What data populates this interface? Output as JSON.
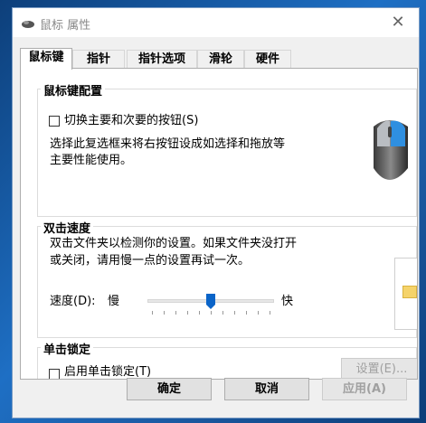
{
  "window": {
    "title": "鼠标 属性",
    "close_symbol": "✕"
  },
  "tabs": [
    {
      "label": "鼠标键",
      "active": true
    },
    {
      "label": "指针",
      "active": false
    },
    {
      "label": "指针选项",
      "active": false
    },
    {
      "label": "滑轮",
      "active": false
    },
    {
      "label": "硬件",
      "active": false
    }
  ],
  "button_config": {
    "title": "鼠标键配置",
    "checkbox_label": "切换主要和次要的按钮(S)",
    "checked": false,
    "description_line1": "选择此复选框来将右按钮设成如选择和拖放等",
    "description_line2": "主要性能使用。"
  },
  "double_click": {
    "title": "双击速度",
    "description_line1": "双击文件夹以检测你的设置。如果文件夹没打开",
    "description_line2": "或关闭，请用慢一点的设置再试一次。",
    "speed_label": "速度(D):",
    "slow_label": "慢",
    "fast_label": "快",
    "speed_level": 0.5
  },
  "click_lock": {
    "title": "单击锁定",
    "checkbox_label": "启用单击锁定(T)",
    "checked": false,
    "settings_button": "设置(E)..."
  },
  "footer": {
    "ok": "确定",
    "cancel": "取消",
    "apply": "应用(A)"
  },
  "icons": [
    "mouse-icon",
    "close-icon",
    "mouse-illustration-icon",
    "folder-preview-icon"
  ]
}
